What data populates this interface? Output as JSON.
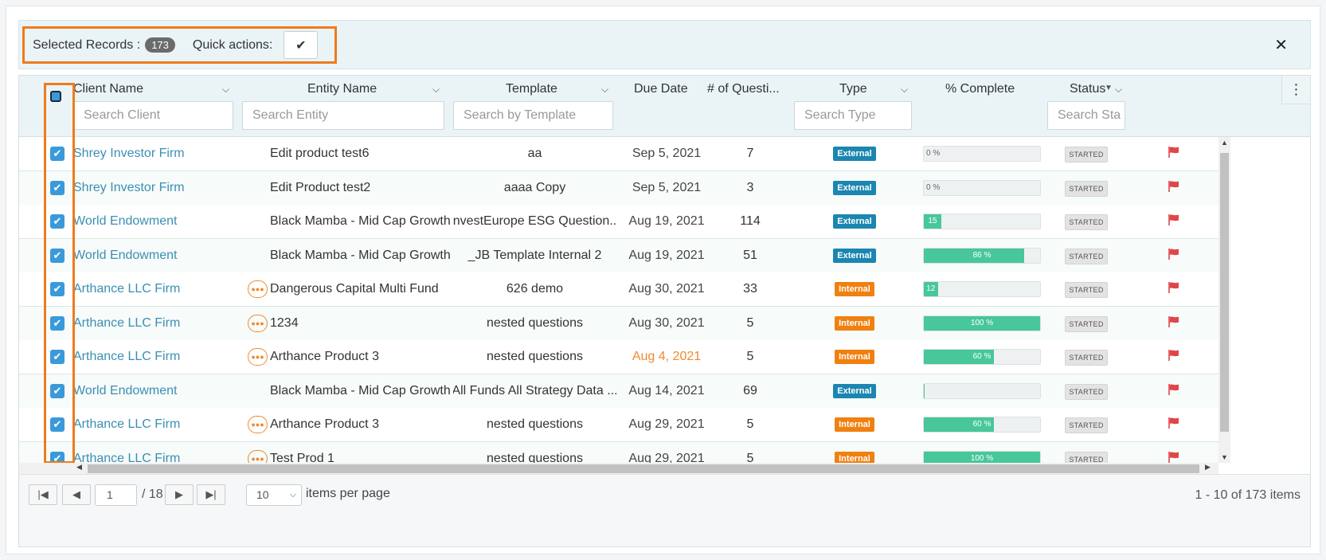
{
  "selection_bar": {
    "label": "Selected Records :",
    "count": "173",
    "quick_actions_label": "Quick actions:",
    "quick_action_icon": "check-icon",
    "close_icon": "close-icon"
  },
  "columns": {
    "client": "Client Name",
    "entity": "Entity Name",
    "template": "Template",
    "due_date": "Due Date",
    "questions": "# of Questi...",
    "type": "Type",
    "complete": "% Complete",
    "status": "Status"
  },
  "filters": {
    "client_placeholder": "Search Client",
    "entity_placeholder": "Search Entity",
    "template_placeholder": "Search by Template",
    "type_placeholder": "Search Type",
    "status_placeholder": "Search Sta"
  },
  "rows": [
    {
      "client": "Shrey Investor Firm",
      "entity": "Edit product test6",
      "template": "aa",
      "due": "Sep 5, 2021",
      "late": false,
      "questions": "7",
      "type": "External",
      "pct": 0,
      "pct_label": "0 %",
      "status": "STARTED",
      "entity_icon": false
    },
    {
      "client": "Shrey Investor Firm",
      "entity": "Edit Product test2",
      "template": "aaaa Copy",
      "due": "Sep 5, 2021",
      "late": false,
      "questions": "3",
      "type": "External",
      "pct": 0,
      "pct_label": "0 %",
      "status": "STARTED",
      "entity_icon": false
    },
    {
      "client": "World Endowment",
      "entity": "Black Mamba - Mid Cap Growth",
      "template": "InvestEurope ESG Question...",
      "due": "Aug 19, 2021",
      "late": false,
      "questions": "114",
      "type": "External",
      "pct": 15,
      "pct_label": "15 %",
      "status": "STARTED",
      "entity_icon": false
    },
    {
      "client": "World Endowment",
      "entity": "Black Mamba - Mid Cap Growth",
      "template": "_JB Template Internal 2",
      "due": "Aug 19, 2021",
      "late": false,
      "questions": "51",
      "type": "External",
      "pct": 86,
      "pct_label": "86 %",
      "status": "STARTED",
      "entity_icon": false
    },
    {
      "client": "Arthance LLC Firm",
      "entity": "Dangerous Capital Multi Fund",
      "template": "626 demo",
      "due": "Aug 30, 2021",
      "late": false,
      "questions": "33",
      "type": "Internal",
      "pct": 12,
      "pct_label": "12 %",
      "status": "STARTED",
      "entity_icon": true
    },
    {
      "client": "Arthance LLC Firm",
      "entity": "1234",
      "template": "nested questions",
      "due": "Aug 30, 2021",
      "late": false,
      "questions": "5",
      "type": "Internal",
      "pct": 100,
      "pct_label": "100 %",
      "status": "STARTED",
      "entity_icon": true
    },
    {
      "client": "Arthance LLC Firm",
      "entity": "Arthance Product 3",
      "template": "nested questions",
      "due": "Aug 4, 2021",
      "late": true,
      "questions": "5",
      "type": "Internal",
      "pct": 60,
      "pct_label": "60 %",
      "status": "STARTED",
      "entity_icon": true
    },
    {
      "client": "World Endowment",
      "entity": "Black Mamba - Mid Cap Growth",
      "template": "All Funds All Strategy Data ...",
      "due": "Aug 14, 2021",
      "late": false,
      "questions": "69",
      "type": "External",
      "pct": 1,
      "pct_label": "",
      "status": "STARTED",
      "entity_icon": false
    },
    {
      "client": "Arthance LLC Firm",
      "entity": "Arthance Product 3",
      "template": "nested questions",
      "due": "Aug 29, 2021",
      "late": false,
      "questions": "5",
      "type": "Internal",
      "pct": 60,
      "pct_label": "60 %",
      "status": "STARTED",
      "entity_icon": true
    },
    {
      "client": "Arthance LLC Firm",
      "entity": "Test Prod 1",
      "template": "nested questions",
      "due": "Aug 29, 2021",
      "late": false,
      "questions": "5",
      "type": "Internal",
      "pct": 100,
      "pct_label": "100 %",
      "status": "STARTED",
      "entity_icon": true
    }
  ],
  "pager": {
    "page": "1",
    "total_pages": "/ 18",
    "page_size": "10",
    "items_per_page_label": "items per page",
    "info": "1 - 10 of 173 items"
  },
  "colors": {
    "accent_orange": "#ef7b1c",
    "link_blue": "#3b8fb3",
    "progress_green": "#47c79a",
    "external_blue": "#1b86b0",
    "internal_orange": "#f08010",
    "flag_red": "#e0454a"
  }
}
